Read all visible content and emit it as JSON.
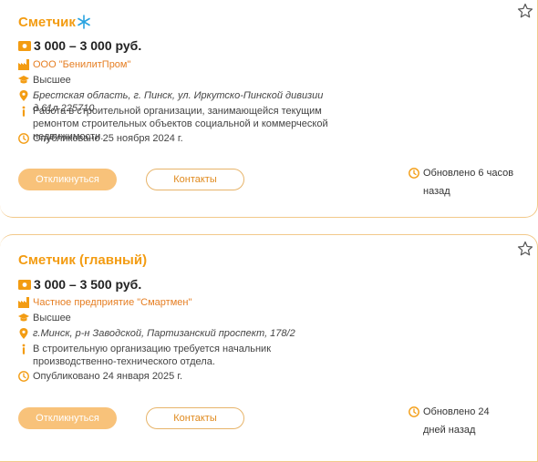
{
  "colors": {
    "accent": "#f39c12",
    "button_fill": "#f8c27a",
    "border": "#f2c98a"
  },
  "vacancies": [
    {
      "title": "Сметчик",
      "salary": "3 000 – 3 000 руб.",
      "company": "ООО \"БенилитПром\"",
      "education": "Высшее",
      "address": "Брестская область, г. Пинск, ул. Иркутско-Пинской дивизии д.61л 225710",
      "description": "Работа в строительной организации, занимающейся текущим ремонтом строительных объектов социальной и коммерческой недвижимости.",
      "published": "Опубликовано 25 ноября 2024 г.",
      "apply_label": "Откликнуться",
      "contacts_label": "Контакты",
      "updated": "Обновлено 6 часов назад"
    },
    {
      "title": "Сметчик (главный)",
      "salary": "3 000 – 3 500 руб.",
      "company": "Частное предприятие \"Смартмен\"",
      "education": "Высшее",
      "address": "г.Минск, р-н Заводской, Партизанский проспект, 178/2",
      "description": "В строительную организацию требуется начальник производственно-технического отдела.",
      "published": "Опубликовано 24 января 2025 г.",
      "apply_label": "Откликнуться",
      "contacts_label": "Контакты",
      "updated": "Обновлено 24 дней назад"
    }
  ],
  "icons": [
    "snowflake-icon",
    "star-icon",
    "money-icon",
    "factory-icon",
    "graduation-cap-icon",
    "location-pin-icon",
    "info-icon",
    "clock-icon"
  ]
}
